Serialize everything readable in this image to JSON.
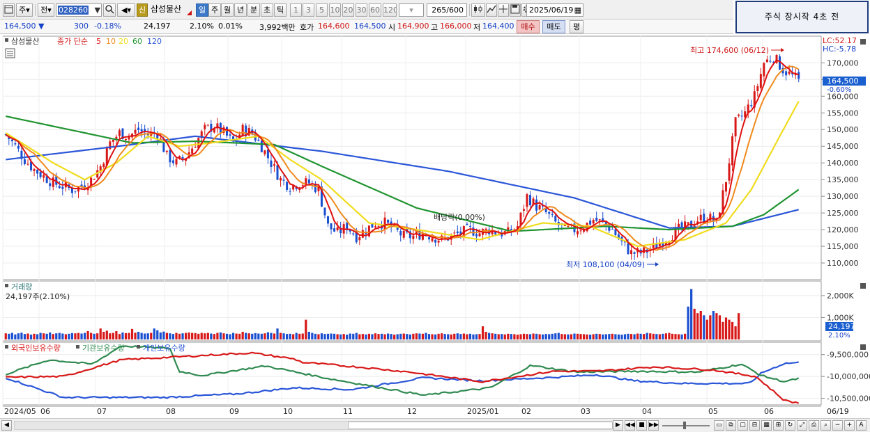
{
  "toolbar": {
    "menu_icon": "window-menu-icon",
    "market": "주",
    "prev": "전",
    "code": "028260",
    "new_label": "신",
    "name": "삼성물산",
    "periods": [
      "일",
      "주",
      "월",
      "년",
      "분",
      "초",
      "틱"
    ],
    "active_period": "일",
    "intervals": [
      "1",
      "3",
      "5",
      "10",
      "20",
      "30",
      "60",
      "120"
    ],
    "count": "265",
    "count_total": "/600",
    "date": "2025/06/19"
  },
  "notice": "주식 장시작 4초 전",
  "quote": {
    "price": "164,500",
    "change": "300",
    "change_pct": "-0.18%",
    "volume": "24,197",
    "vol_ratio": "2.10%",
    "turnover": "0.01%",
    "amount": "3,992백만",
    "ask_label": "호가",
    "ask": "164,600",
    "bid": "164,500",
    "open_label": "시",
    "open": "164,900",
    "high_label": "고",
    "high": "166,000",
    "low_label": "저",
    "low": "164,400",
    "buy": "매수",
    "sell": "매도",
    "eval": "평"
  },
  "price_panel": {
    "title": "삼성물산",
    "legend_label": "종가 단순",
    "ma_periods": [
      "5",
      "10",
      "20",
      "60",
      "120"
    ],
    "ma_colors": [
      "#e01010",
      "#f08a1c",
      "#f0dc1c",
      "#1f9430",
      "#2a56d8"
    ],
    "lc": "LC:52.17",
    "hc": "HC:-5.78",
    "price_tag": "164,500",
    "pct_tag": "-0.60%",
    "high_note": "최고 174,600 (06/12)",
    "low_note": "최저 108,100 (04/09)",
    "dividend_note": "배당락(0.00%)",
    "y_ticks": [
      "170,000",
      "165,000",
      "160,000",
      "155,000",
      "150,000",
      "145,000",
      "140,000",
      "135,000",
      "130,000",
      "125,000",
      "120,000",
      "115,000",
      "110,000"
    ]
  },
  "volume_panel": {
    "title": "거래량",
    "subtitle": "24,197주(2.10%)",
    "tag": "24,197",
    "tag_pct": "2.10%",
    "y_ticks": [
      "2,000K",
      "1,000K"
    ]
  },
  "holding_panel": {
    "legend": [
      "외국인보유수량",
      "기관보유수량",
      "개인보유수량"
    ],
    "colors": [
      "#d81818",
      "#2f8a50",
      "#2a56d8"
    ],
    "y_ticks": [
      "-9,500,000",
      "-10,000,000",
      "-10,500,000"
    ]
  },
  "x_axis": [
    "2024/05",
    "06",
    "07",
    "08",
    "09",
    "10",
    "11",
    "12",
    "2025/01",
    "02",
    "03",
    "04",
    "05",
    "06",
    "06/19"
  ],
  "chart_data": {
    "type": "candlestick",
    "title": "삼성물산",
    "y_range": [
      105000,
      178000
    ],
    "price_path": [
      [
        0,
        148500
      ],
      [
        3,
        145000
      ],
      [
        6,
        141000
      ],
      [
        9,
        138000
      ],
      [
        12,
        136000
      ],
      [
        15,
        134000
      ],
      [
        18,
        133000
      ],
      [
        21,
        132000
      ],
      [
        24,
        133000
      ],
      [
        27,
        135000
      ],
      [
        30,
        139000
      ],
      [
        33,
        146000
      ],
      [
        36,
        149000
      ],
      [
        39,
        148000
      ],
      [
        42,
        150000
      ],
      [
        45,
        148500
      ],
      [
        48,
        149000
      ],
      [
        51,
        142000
      ],
      [
        54,
        140000
      ],
      [
        57,
        142000
      ],
      [
        60,
        146000
      ],
      [
        63,
        150000
      ],
      [
        66,
        151000
      ],
      [
        69,
        149000
      ],
      [
        72,
        146000
      ],
      [
        75,
        150000
      ],
      [
        78,
        149000
      ],
      [
        81,
        145000
      ],
      [
        84,
        140000
      ],
      [
        87,
        135000
      ],
      [
        90,
        133000
      ],
      [
        93,
        134000
      ],
      [
        96,
        134000
      ],
      [
        99,
        132000
      ],
      [
        102,
        121000
      ],
      [
        105,
        119000
      ],
      [
        108,
        121000
      ],
      [
        111,
        118000
      ],
      [
        114,
        120000
      ],
      [
        117,
        122000
      ],
      [
        120,
        122000
      ],
      [
        123,
        120000
      ],
      [
        126,
        118000
      ],
      [
        129,
        118000
      ],
      [
        132,
        119000
      ],
      [
        135,
        118000
      ],
      [
        138,
        117000
      ],
      [
        141,
        118000
      ],
      [
        144,
        119000
      ],
      [
        147,
        120000
      ],
      [
        150,
        119000
      ],
      [
        153,
        120000
      ],
      [
        156,
        119000
      ],
      [
        159,
        119000
      ],
      [
        162,
        121000
      ],
      [
        165,
        130000
      ],
      [
        168,
        127000
      ],
      [
        171,
        125000
      ],
      [
        174,
        122000
      ],
      [
        177,
        120000
      ],
      [
        180,
        120000
      ],
      [
        183,
        121000
      ],
      [
        186,
        123000
      ],
      [
        189,
        122000
      ],
      [
        192,
        120000
      ],
      [
        195,
        116000
      ],
      [
        198,
        113000
      ],
      [
        201,
        113000
      ],
      [
        204,
        114000
      ],
      [
        207,
        116000
      ],
      [
        210,
        118000
      ],
      [
        213,
        120000
      ],
      [
        216,
        121000
      ],
      [
        219,
        123000
      ],
      [
        222,
        124000
      ],
      [
        225,
        122000
      ],
      [
        228,
        135000
      ],
      [
        231,
        152000
      ],
      [
        234,
        155000
      ],
      [
        237,
        160000
      ],
      [
        240,
        170000
      ],
      [
        243,
        172000
      ],
      [
        246,
        168000
      ],
      [
        249,
        166000
      ],
      [
        251,
        164500
      ]
    ],
    "ma120_path": [
      [
        0,
        141000
      ],
      [
        40,
        145500
      ],
      [
        60,
        148000
      ],
      [
        100,
        143500
      ],
      [
        140,
        137500
      ],
      [
        180,
        129500
      ],
      [
        210,
        120500
      ],
      [
        230,
        121000
      ],
      [
        251,
        126000
      ]
    ],
    "ma60_path": [
      [
        0,
        154000
      ],
      [
        20,
        150000
      ],
      [
        40,
        146000
      ],
      [
        60,
        146500
      ],
      [
        85,
        145500
      ],
      [
        100,
        139000
      ],
      [
        130,
        126500
      ],
      [
        160,
        119500
      ],
      [
        190,
        121000
      ],
      [
        210,
        120000
      ],
      [
        230,
        121000
      ],
      [
        240,
        124500
      ],
      [
        251,
        132000
      ]
    ],
    "ma20_path": [
      [
        0,
        149000
      ],
      [
        15,
        140000
      ],
      [
        25,
        135000
      ],
      [
        35,
        140000
      ],
      [
        45,
        148000
      ],
      [
        55,
        145000
      ],
      [
        65,
        146000
      ],
      [
        80,
        148000
      ],
      [
        90,
        141000
      ],
      [
        100,
        135000
      ],
      [
        115,
        122000
      ],
      [
        130,
        120000
      ],
      [
        150,
        117000
      ],
      [
        170,
        122000
      ],
      [
        185,
        121000
      ],
      [
        200,
        115000
      ],
      [
        215,
        117000
      ],
      [
        228,
        122000
      ],
      [
        236,
        132000
      ],
      [
        245,
        148000
      ],
      [
        251,
        158500
      ]
    ],
    "volume_k": [
      280,
      260,
      300,
      230,
      280,
      310,
      250,
      270,
      220,
      260,
      240,
      300,
      280,
      260,
      320,
      250,
      280,
      300,
      270,
      240,
      260,
      290,
      280,
      300,
      270,
      300,
      380,
      300,
      260,
      280,
      500,
      350,
      400,
      280,
      300,
      380,
      250,
      320,
      290,
      300,
      480,
      310,
      350,
      300,
      270,
      280,
      300,
      500,
      420,
      320,
      360,
      300,
      280,
      250,
      300,
      260,
      280,
      300,
      320,
      300,
      290,
      260,
      300,
      280,
      300,
      270,
      250,
      300,
      320,
      280,
      260,
      240,
      300,
      270,
      260,
      350,
      300,
      280,
      260,
      290,
      270,
      260,
      280,
      330,
      300,
      270,
      500,
      300,
      280,
      250,
      260,
      240,
      300,
      260,
      270,
      900,
      350,
      300,
      260,
      240,
      280,
      250,
      260,
      270,
      260,
      240,
      230,
      250,
      220,
      270,
      260,
      300,
      240,
      250,
      230,
      260,
      240,
      280,
      250,
      260,
      240,
      270,
      250,
      220,
      240,
      260,
      270,
      250,
      230,
      260,
      280,
      270,
      260,
      300,
      250,
      240,
      230,
      260,
      280,
      250,
      240,
      230,
      260,
      280,
      250,
      270,
      240,
      260,
      230,
      240,
      250,
      600,
      350,
      300,
      280,
      260,
      240,
      250,
      230,
      260,
      250,
      240,
      220,
      240,
      260,
      250,
      240,
      270,
      260,
      240,
      230,
      250,
      240,
      260,
      280,
      300,
      250,
      240,
      230,
      240,
      270,
      260,
      250,
      240,
      230,
      220,
      240,
      260,
      250,
      230,
      240,
      250,
      260,
      240,
      230,
      220,
      240,
      260,
      250,
      240,
      270,
      260,
      250,
      300,
      280,
      260,
      250,
      240,
      260,
      280,
      300,
      260,
      250,
      240,
      230,
      260,
      1500,
      2300,
      1400,
      1200,
      1300,
      1100,
      900,
      1100,
      1300,
      1200,
      1100,
      800,
      1000,
      900,
      800,
      600,
      1200
    ]
  }
}
